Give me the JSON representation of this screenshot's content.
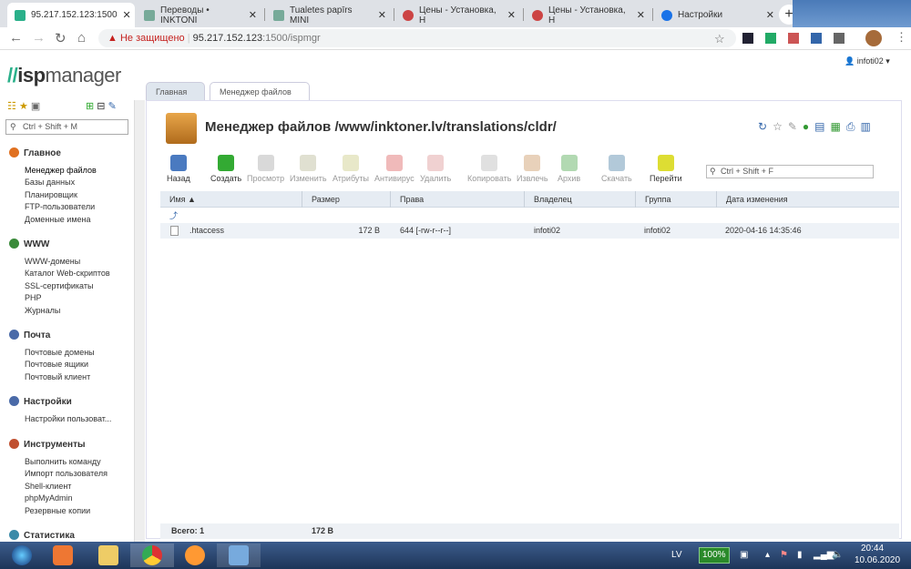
{
  "browser": {
    "tabs": [
      {
        "title": "95.217.152.123:1500"
      },
      {
        "title": "Переводы • INKTONI"
      },
      {
        "title": "Tualetes papīrs MINI"
      },
      {
        "title": "Цены - Установка, Н"
      },
      {
        "title": "Цены - Установка, Н"
      },
      {
        "title": "Настройки"
      }
    ],
    "security": "Не защищено",
    "url_host": "95.217.152.123",
    "url_rest": ":1500/ispmgr"
  },
  "app": {
    "logo_a": "isp",
    "logo_b": "manager",
    "user": "infoti02",
    "search_placeholder": "Ctrl + Shift + M"
  },
  "sidebar": {
    "groups": [
      {
        "label": "Главное",
        "color": "#e07020",
        "items": [
          "Менеджер файлов",
          "Базы данных",
          "Планировщик",
          "FTP-пользователи",
          "Доменные имена"
        ]
      },
      {
        "label": "WWW",
        "color": "#3a8a3a",
        "items": [
          "WWW-домены",
          "Каталог Web-скриптов",
          "SSL-сертификаты",
          "PHP",
          "Журналы"
        ]
      },
      {
        "label": "Почта",
        "color": "#4a6aa8",
        "items": [
          "Почтовые домены",
          "Почтовые ящики",
          "Почтовый клиент"
        ]
      },
      {
        "label": "Настройки",
        "color": "#4a6aa8",
        "items": [
          "Настройки пользоват..."
        ]
      },
      {
        "label": "Инструменты",
        "color": "#c05030",
        "items": [
          "Выполнить команду",
          "Импорт пользователя",
          "Shell-клиент",
          "phpMyAdmin",
          "Резервные копии"
        ]
      },
      {
        "label": "Статистика",
        "color": "#3a8aa8",
        "items": []
      }
    ]
  },
  "page_tabs": [
    "Главная",
    "Менеджер файлов"
  ],
  "title": "Менеджер файлов /www/inktoner.lv/translations/cldr/",
  "toolbar": [
    {
      "label": "Назад",
      "on": true
    },
    {
      "label": "Создать",
      "on": true
    },
    {
      "label": "Просмотр",
      "on": false
    },
    {
      "label": "Изменить",
      "on": false
    },
    {
      "label": "Атрибуты",
      "on": false
    },
    {
      "label": "Антивирус",
      "on": false
    },
    {
      "label": "Удалить",
      "on": false
    },
    {
      "label": "Копировать",
      "on": false
    },
    {
      "label": "Извлечь",
      "on": false
    },
    {
      "label": "Архив",
      "on": false
    },
    {
      "label": "Скачать",
      "on": false
    },
    {
      "label": "Перейти",
      "on": true
    }
  ],
  "filter_placeholder": "Ctrl + Shift + F",
  "table": {
    "headers": [
      "Имя ▲",
      "Размер",
      "Права",
      "Владелец",
      "Группа",
      "Дата изменения"
    ],
    "rows": [
      {
        "name": ".htaccess",
        "size": "172 B",
        "perms": "644 [-rw-r--r--]",
        "owner": "infoti02",
        "group": "infoti02",
        "date": "2020-04-16 14:35:46"
      }
    ]
  },
  "footer": {
    "total": "Всего: 1",
    "size": "172 B"
  },
  "taskbar": {
    "lang": "LV",
    "battery": "100%",
    "time": "20:44",
    "date": "10.06.2020"
  }
}
